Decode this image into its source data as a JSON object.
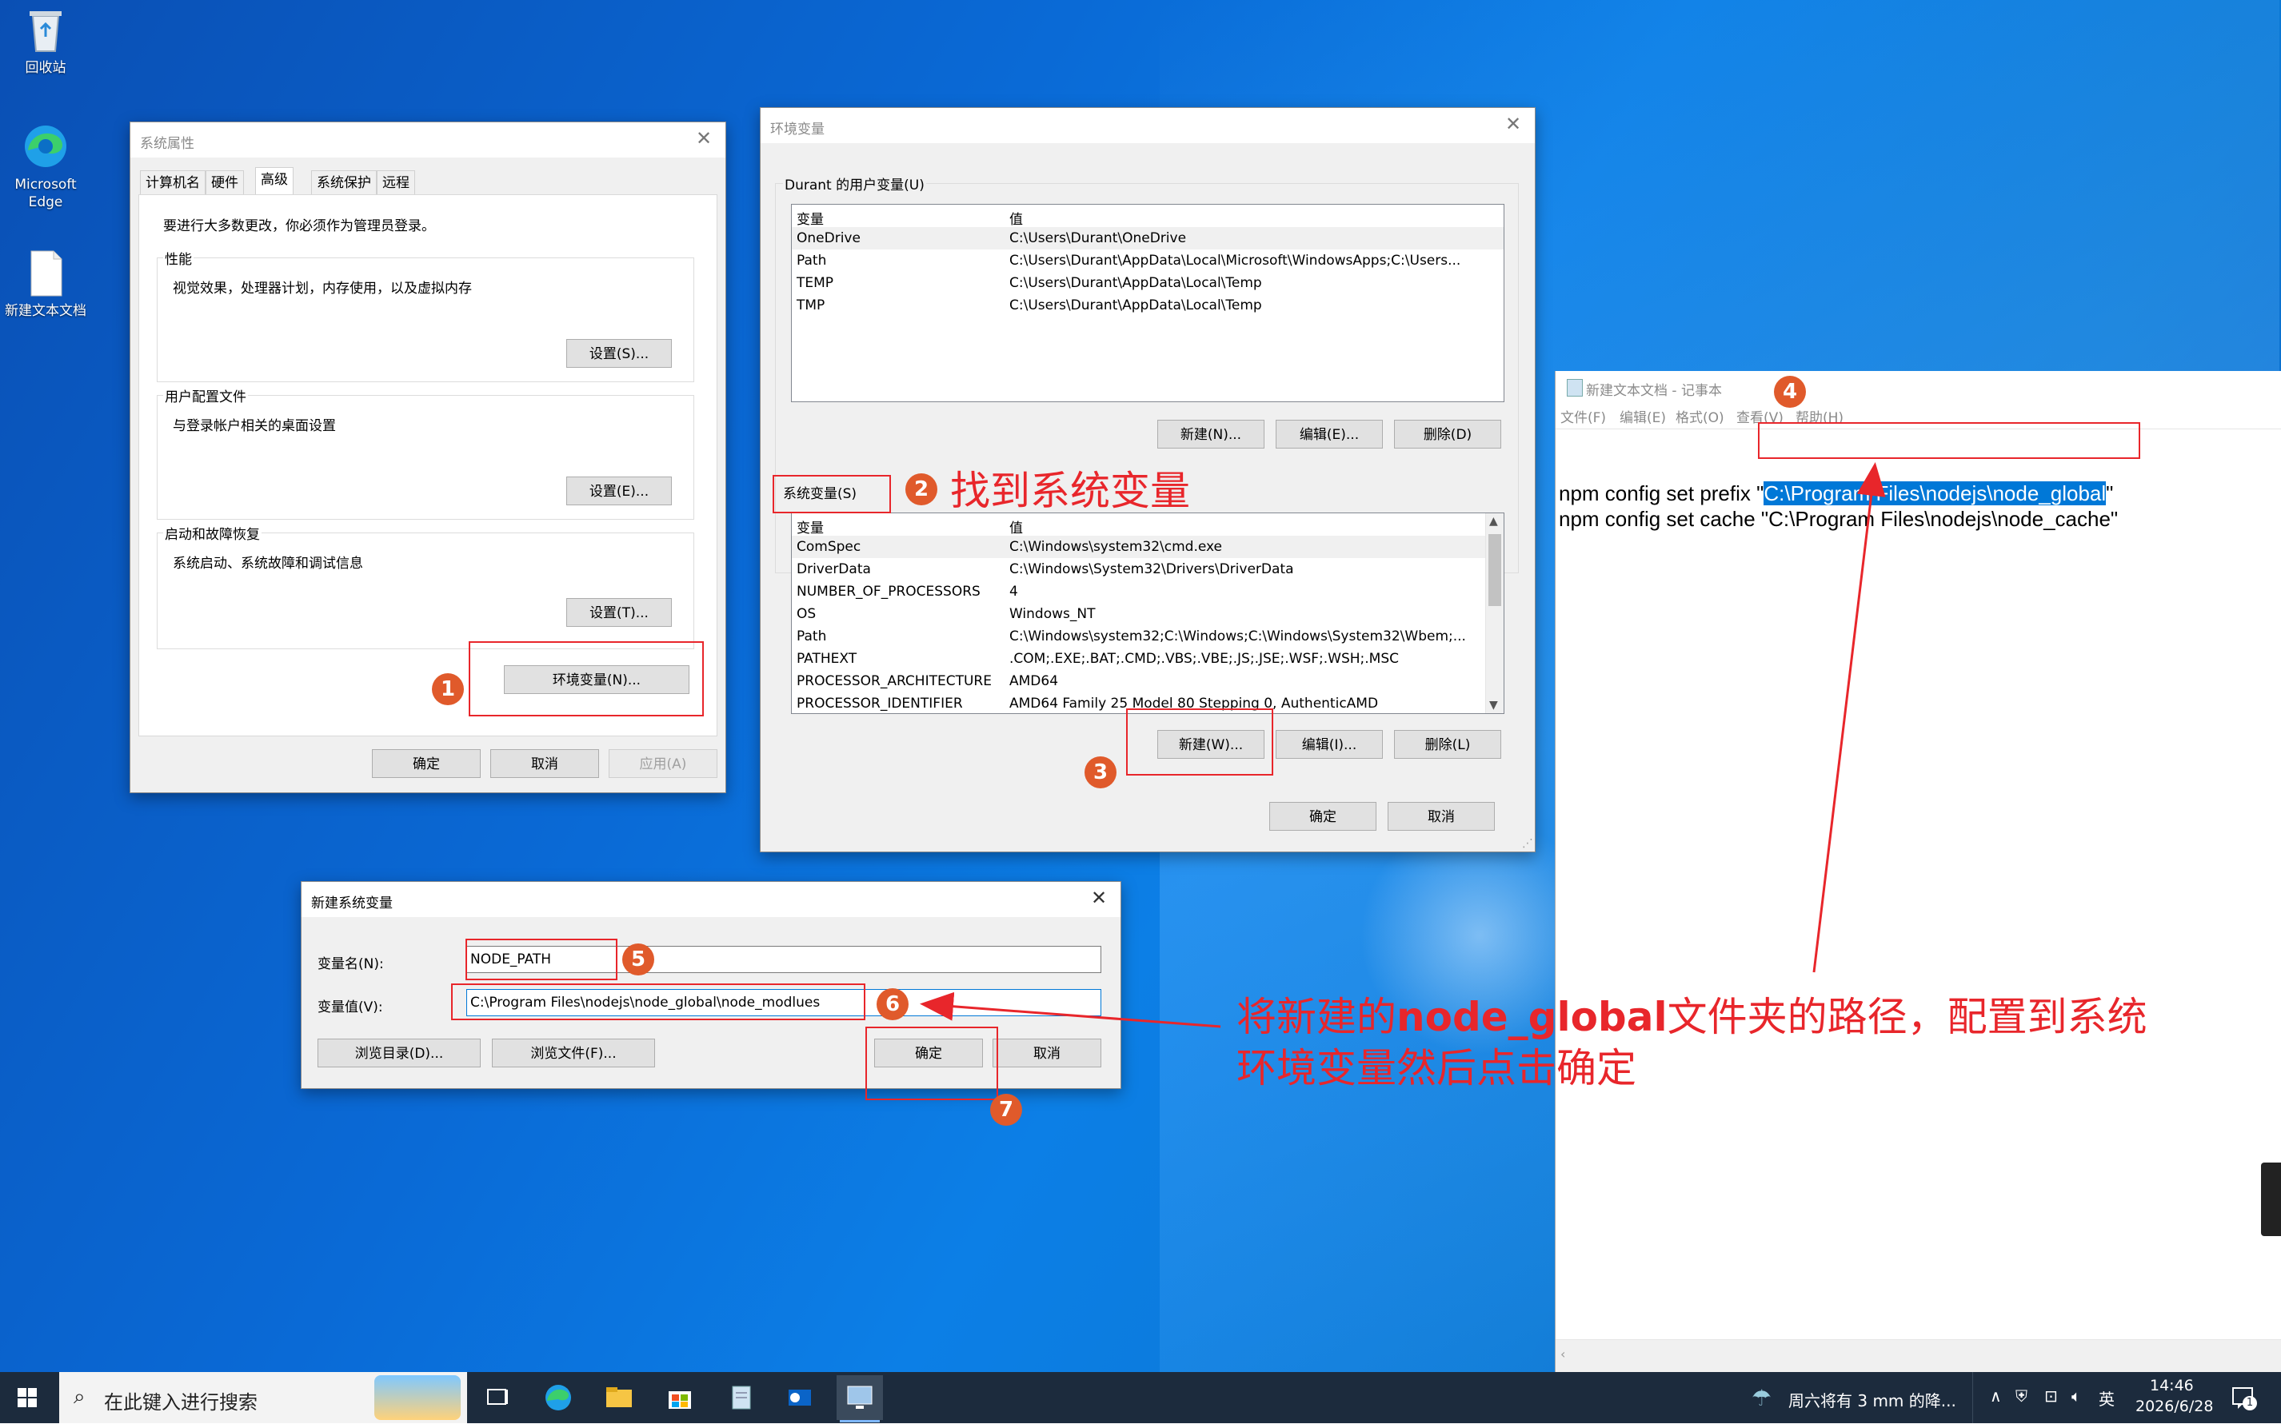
{
  "desktop": {
    "icons": [
      {
        "label": "回收站"
      },
      {
        "label": "Microsoft Edge"
      },
      {
        "label": "新建文本文档"
      }
    ]
  },
  "sysprops": {
    "title": "系统属性",
    "tabs": [
      "计算机名",
      "硬件",
      "高级",
      "系统保护",
      "远程"
    ],
    "active_tab": "高级",
    "admin_note": "要进行大多数更改，你必须作为管理员登录。",
    "perf_label": "性能",
    "perf_desc": "视觉效果，处理器计划，内存使用，以及虚拟内存",
    "perf_btn": "设置(S)...",
    "profile_label": "用户配置文件",
    "profile_desc": "与登录帐户相关的桌面设置",
    "profile_btn": "设置(E)...",
    "startup_label": "启动和故障恢复",
    "startup_desc": "系统启动、系统故障和调试信息",
    "startup_btn": "设置(T)...",
    "env_btn": "环境变量(N)...",
    "ok": "确定",
    "cancel": "取消",
    "apply": "应用(A)"
  },
  "envvars": {
    "title": "环境变量",
    "user_group": "Durant 的用户变量(U)",
    "col_var": "变量",
    "col_val": "值",
    "user_rows": [
      {
        "name": "OneDrive",
        "value": "C:\\Users\\Durant\\OneDrive"
      },
      {
        "name": "Path",
        "value": "C:\\Users\\Durant\\AppData\\Local\\Microsoft\\WindowsApps;C:\\Users..."
      },
      {
        "name": "TEMP",
        "value": "C:\\Users\\Durant\\AppData\\Local\\Temp"
      },
      {
        "name": "TMP",
        "value": "C:\\Users\\Durant\\AppData\\Local\\Temp"
      }
    ],
    "user_new": "新建(N)...",
    "user_edit": "编辑(E)...",
    "user_delete": "删除(D)",
    "sys_group": "系统变量(S)",
    "sys_rows": [
      {
        "name": "ComSpec",
        "value": "C:\\Windows\\system32\\cmd.exe"
      },
      {
        "name": "DriverData",
        "value": "C:\\Windows\\System32\\Drivers\\DriverData"
      },
      {
        "name": "NUMBER_OF_PROCESSORS",
        "value": "4"
      },
      {
        "name": "OS",
        "value": "Windows_NT"
      },
      {
        "name": "Path",
        "value": "C:\\Windows\\system32;C:\\Windows;C:\\Windows\\System32\\Wbem;..."
      },
      {
        "name": "PATHEXT",
        "value": ".COM;.EXE;.BAT;.CMD;.VBS;.VBE;.JS;.JSE;.WSF;.WSH;.MSC"
      },
      {
        "name": "PROCESSOR_ARCHITECTURE",
        "value": "AMD64"
      },
      {
        "name": "PROCESSOR_IDENTIFIER",
        "value": "AMD64 Family 25 Model 80 Stepping 0, AuthenticAMD"
      }
    ],
    "sys_new": "新建(W)...",
    "sys_edit": "编辑(I)...",
    "sys_delete": "删除(L)",
    "ok": "确定",
    "cancel": "取消"
  },
  "newvar": {
    "title": "新建系统变量",
    "name_label": "变量名(N):",
    "name_value": "NODE_PATH",
    "value_label": "变量值(V):",
    "value_value": "C:\\Program Files\\nodejs\\node_global\\node_modlues",
    "browse_dir": "浏览目录(D)...",
    "browse_file": "浏览文件(F)...",
    "ok": "确定",
    "cancel": "取消"
  },
  "notepad": {
    "title": "新建文本文档 - 记事本",
    "menu": [
      "文件(F)",
      "编辑(E)",
      "格式(O)",
      "查看(V)",
      "帮助(H)"
    ],
    "line1_prefix": "npm config set prefix \"",
    "line1_selected": "C:\\Program Files\\nodejs\\node_global",
    "line1_suffix": "\"",
    "line2": "npm config set cache \"C:\\Program Files\\nodejs\\node_cache\""
  },
  "annotations": {
    "badges": [
      "1",
      "2",
      "3",
      "4",
      "5",
      "6",
      "7"
    ],
    "step2_text": "找到系统变量",
    "bottom_pre": "将新建的",
    "bottom_bold": "node_global",
    "bottom_post": "文件夹的路径，配置到系统",
    "bottom_line2": "环境变量然后点击确定",
    "color": "#e8262b"
  },
  "taskbar": {
    "search_placeholder": "在此键入进行搜索",
    "weather": "周六将有 3 mm 的降...",
    "ime": "英",
    "time": "14:46",
    "date": "2026/6/28",
    "notif_count": "1"
  }
}
